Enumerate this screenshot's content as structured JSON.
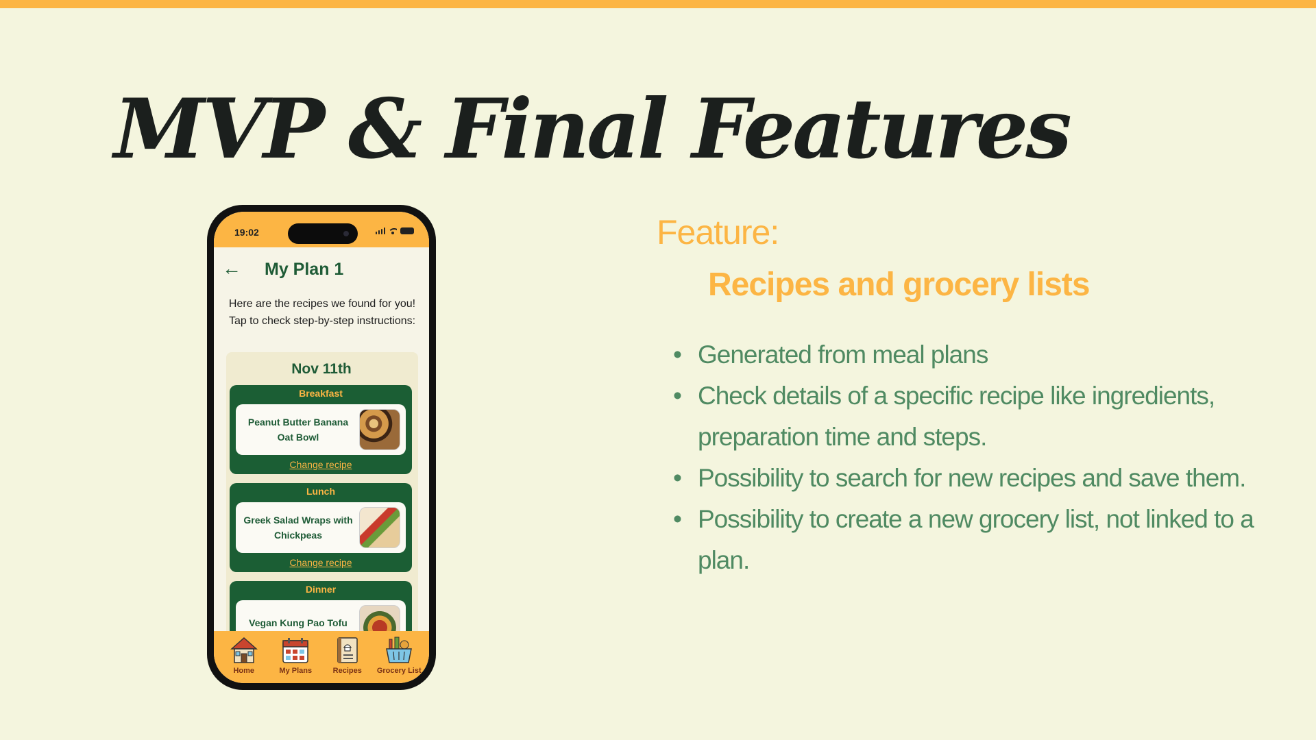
{
  "slide": {
    "title": "MVP & Final Features",
    "feature_label": "Feature:",
    "feature_title": "Recipes and grocery lists",
    "bullets": [
      "Generated from meal plans",
      "Check details of a specific recipe like ingredients, preparation time and steps.",
      "Possibility to search for new recipes and save them.",
      "Possibility to create a new grocery list, not linked to a plan."
    ]
  },
  "phone": {
    "status_time": "19:02",
    "header": {
      "back_icon": "arrow-left-icon",
      "title": "My Plan 1"
    },
    "intro": "Here are the recipes we found for you! Tap to check step-by-step instructions:",
    "day": "Nov 11th",
    "meals": [
      {
        "label": "Breakfast",
        "name": "Peanut Butter Banana Oat Bowl",
        "change": "Change recipe"
      },
      {
        "label": "Lunch",
        "name": "Greek Salad Wraps with Chickpeas",
        "change": "Change recipe"
      },
      {
        "label": "Dinner",
        "name": "Vegan Kung Pao Tofu"
      }
    ],
    "tabs": [
      {
        "label": "Home",
        "icon": "house-icon"
      },
      {
        "label": "My Plans",
        "icon": "calendar-icon"
      },
      {
        "label": "Recipes",
        "icon": "recipe-book-icon"
      },
      {
        "label": "Grocery List",
        "icon": "grocery-basket-icon"
      }
    ]
  },
  "colors": {
    "accent_orange": "#fcb544",
    "app_green": "#1b5e34",
    "bullet_green": "#4f8a62",
    "background": "#f4f5de"
  }
}
